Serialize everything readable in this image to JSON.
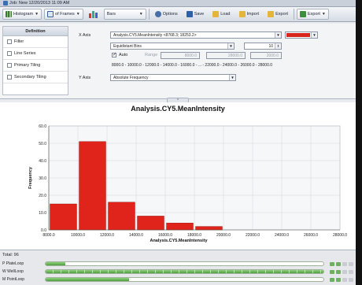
{
  "window": {
    "title": "Job: New 12/20/2013 11:09 AM"
  },
  "toolbar": {
    "histogram_label": "Histogram",
    "frames_label": "of Frames",
    "bars_label": "Bars",
    "options_label": "Options",
    "save_label": "Save",
    "load_label": "Load",
    "import_label": "Import",
    "export_label": "Export",
    "export2_label": "Export"
  },
  "definition": {
    "header": "Definition",
    "items": [
      {
        "label": "Filter",
        "checked": false
      },
      {
        "label": "Line Series",
        "checked": false
      },
      {
        "label": "Primary Tiling",
        "checked": false
      },
      {
        "label": "Secondary Tiling",
        "checked": false
      }
    ],
    "x_axis_label": "X Axis",
    "x_axis_value": "Analysis.CY5.MeanIntensity <8768.3; 18253.2>",
    "color_value": "#d9261c",
    "binning_value": "Equidistant Bins",
    "bins_value": "10",
    "auto_label": "Auto",
    "range_label": "Range",
    "range_from": "8000.0",
    "range_to": "28000.0",
    "range_step": "2000.0",
    "bin_edges": "8000.0 - 10000.0 - 12000.0 - 14000.0 - 16000.0 - ... - 22000.0 - 24000.0 - 26000.0 - 28000.0",
    "y_axis_label": "Y Axis",
    "y_axis_value": "Absolute Frequency",
    "collapse_symbol": "^"
  },
  "chart_data": {
    "type": "bar",
    "title": "Analysis.CY5.MeanIntensity",
    "xlabel": "Analysis.CY5.MeanIntensity",
    "ylabel": "Frequency",
    "bin_width": 2000,
    "bins_start": [
      8000,
      10000,
      12000,
      14000,
      16000,
      18000,
      20000,
      22000,
      24000,
      26000
    ],
    "values": [
      15,
      51,
      16,
      8,
      4,
      2,
      0,
      0,
      0,
      0
    ],
    "xlim": [
      8000,
      28000
    ],
    "ylim": [
      0,
      60
    ],
    "xticks": [
      "8000.0",
      "10000.0",
      "12000.0",
      "14000.0",
      "16000.0",
      "18000.0",
      "20000.0",
      "22000.0",
      "24000.0",
      "26000.0",
      "28000.0"
    ],
    "yticks": [
      "0.0",
      "10.0",
      "20.0",
      "30.0",
      "40.0",
      "50.0",
      "60.0"
    ],
    "grid": true,
    "bar_color": "#e0231b"
  },
  "status": {
    "total_label": "Total: 96",
    "loops": [
      {
        "key": "P",
        "name": "PlateLoop",
        "progress": 0.07
      },
      {
        "key": "W",
        "name": "WellLoop",
        "progress": 1.0
      },
      {
        "key": "M",
        "name": "PointLoop",
        "progress": 0.3
      }
    ]
  }
}
